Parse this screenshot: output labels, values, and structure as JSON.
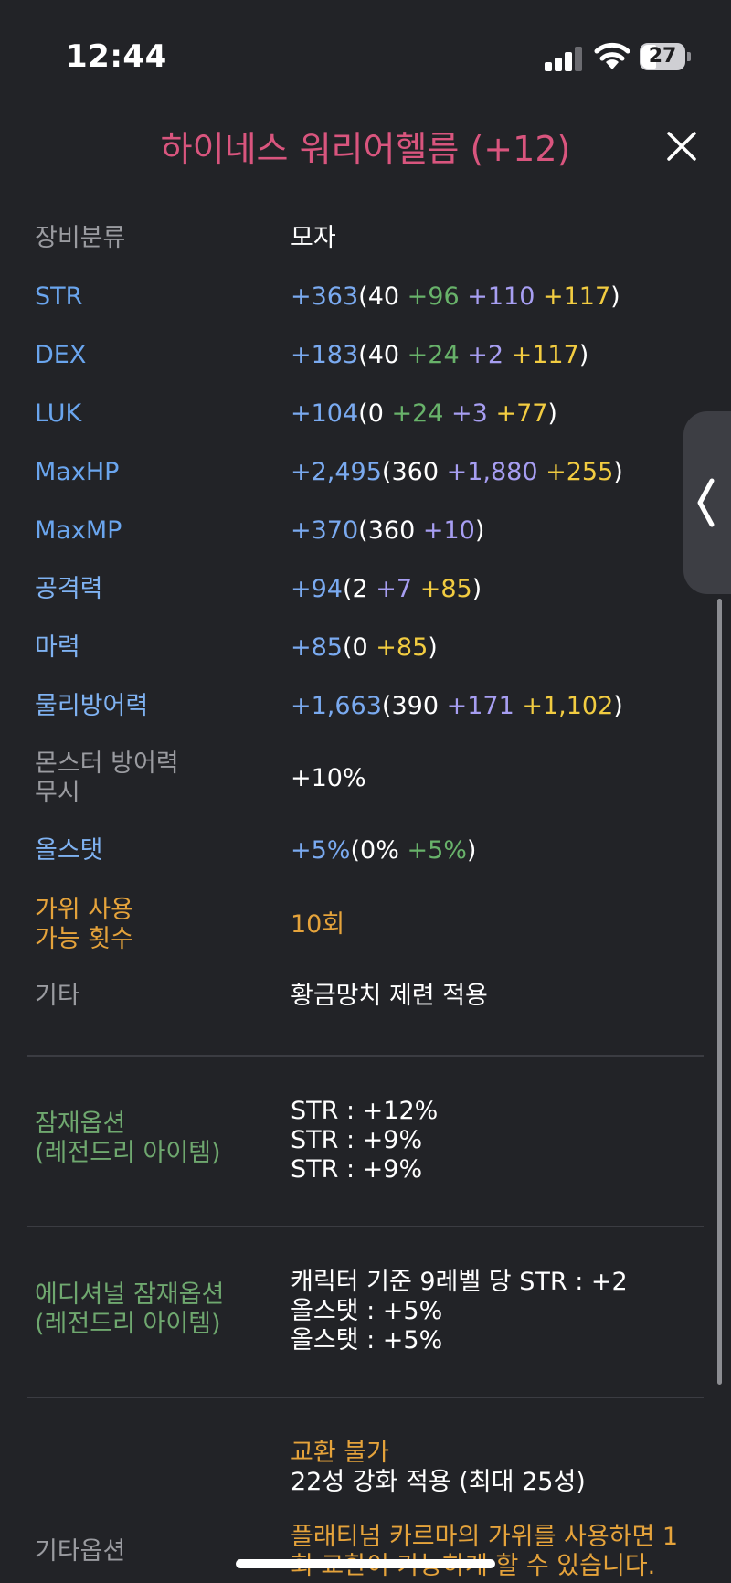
{
  "status_bar": {
    "time": "12:44",
    "battery_level": "27"
  },
  "header": {
    "title": "하이네스 워리어헬름 (+12)"
  },
  "stats": {
    "category": {
      "label": "장비분류",
      "value": "모자"
    },
    "str": {
      "label": "STR",
      "total": "+363",
      "base": "40",
      "p1": " +96",
      "p2": " +110",
      "p3": " +117"
    },
    "dex": {
      "label": "DEX",
      "total": "+183",
      "base": "40",
      "p1": " +24",
      "p2": " +2",
      "p3": " +117"
    },
    "luk": {
      "label": "LUK",
      "total": "+104",
      "base": "0",
      "p1": " +24",
      "p2": " +3",
      "p3": " +77"
    },
    "maxhp": {
      "label": "MaxHP",
      "total": "+2,495",
      "base": "360",
      "p2": " +1,880",
      "p3": " +255"
    },
    "maxmp": {
      "label": "MaxMP",
      "total": "+370",
      "base": "360",
      "p2": " +10"
    },
    "attack": {
      "label": "공격력",
      "total": "+94",
      "base": "2",
      "p2": " +7",
      "p3": " +85"
    },
    "magic": {
      "label": "마력",
      "total": "+85",
      "base": "0",
      "p3": " +85"
    },
    "defense": {
      "label": "물리방어력",
      "total": "+1,663",
      "base": "390",
      "p2": " +171",
      "p3": " +1,102"
    },
    "ignore_def": {
      "label_line1": "몬스터 방어력",
      "label_line2": "무시",
      "value": "+10%"
    },
    "allstat": {
      "label": "올스탯",
      "total": "+5%",
      "base": "0%",
      "p1": " +5%"
    },
    "scissors": {
      "label_line1": "가위 사용",
      "label_line2": "가능 횟수",
      "value": "10회"
    },
    "etc": {
      "label": "기타",
      "value": "황금망치 제련 적용"
    }
  },
  "potential": {
    "label_line1": "잠재옵션",
    "label_line2": "(레전드리 아이템)",
    "lines": [
      "STR : +12%",
      "STR : +9%",
      "STR : +9%"
    ]
  },
  "additional_potential": {
    "label_line1": "에디셔널 잠재옵션",
    "label_line2": "(레전드리 아이템)",
    "lines": [
      "캐릭터 기준 9레벨 당 STR : +2",
      "올스탯 : +5%",
      "올스탯 : +5%"
    ]
  },
  "other_options": {
    "label": "기타옵션",
    "trade": "교환 불가",
    "starforce": "22성 강화 적용 (최대 25성)",
    "scissors_note_line1": "플래티넘 카르마의 가위를 사용하면 1",
    "scissors_note_line2": "회 교환이 가능하게 할 수 있습니다."
  },
  "icons": {
    "close": "close-icon",
    "side_tab": "chevron-left-icon",
    "wifi": "wifi-icon",
    "signal": "signal-icon",
    "battery": "battery-icon"
  }
}
